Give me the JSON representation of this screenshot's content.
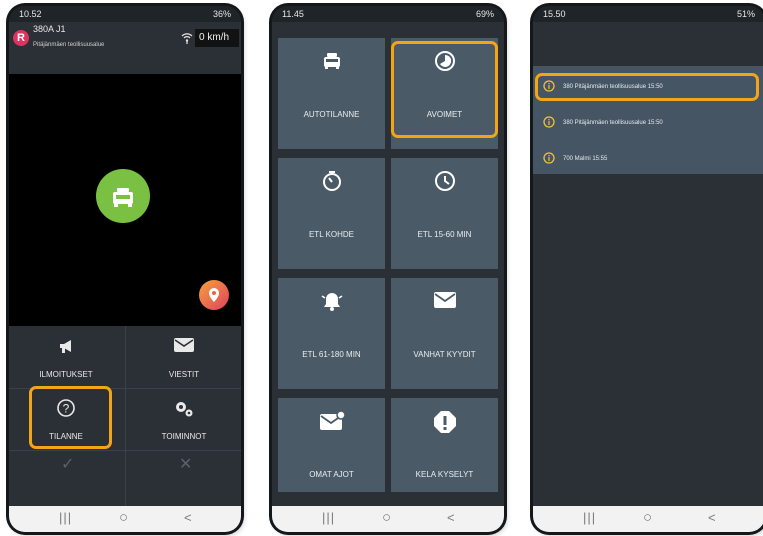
{
  "phone1": {
    "status_time": "10.52",
    "status_right": "36%",
    "vehicle_id": "380A J1",
    "area": "Pitäjänmäen teollisuusalue",
    "speed": "0 km/h",
    "avatar_letter": "R",
    "menu": [
      {
        "label": "ILMOITUKSET",
        "icon": "megaphone-icon"
      },
      {
        "label": "VIESTIT",
        "icon": "envelope-icon"
      },
      {
        "label": "TILANNE",
        "icon": "question-circle-icon",
        "highlighted": true
      },
      {
        "label": "TOIMINNOT",
        "icon": "gears-icon"
      }
    ]
  },
  "phone2": {
    "status_time": "11.45",
    "status_right": "69%",
    "tiles": [
      {
        "label": "AUTOTILANNE",
        "icon": "taxi-icon"
      },
      {
        "label": "AVOIMET",
        "icon": "clock-partial-icon",
        "highlighted": true
      },
      {
        "label": "ETL KOHDE",
        "icon": "timer-icon"
      },
      {
        "label": "ETL 15-60 MIN",
        "icon": "clock-icon"
      },
      {
        "label": "ETL 61-180 MIN",
        "icon": "bell-icon"
      },
      {
        "label": "VANHAT KYYDIT",
        "icon": "envelope-icon"
      },
      {
        "label": "OMAT AJOT",
        "icon": "envelope-badge-icon"
      },
      {
        "label": "KELA KYSELYT",
        "icon": "alert-icon"
      }
    ]
  },
  "phone3": {
    "status_time": "15.50",
    "status_right": "51%",
    "alerts": [
      {
        "text": "380 Pitäjänmäen teollisuusalue  15:50",
        "highlighted": true
      },
      {
        "text": "380 Pitäjänmäen teollisuusalue  15:50"
      },
      {
        "text": "700 Malmi  15:55"
      }
    ]
  },
  "colors": {
    "highlight": "#f2a516",
    "tile": "#4a5a67",
    "green": "#7ac143"
  }
}
